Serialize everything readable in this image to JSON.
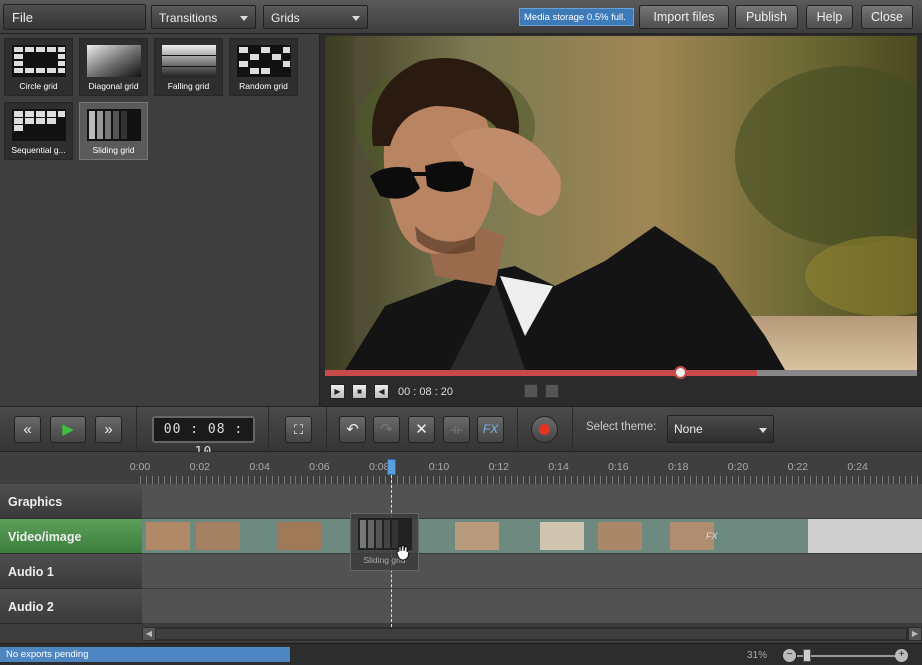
{
  "header": {
    "file_menu": "File",
    "category_dropdown": "Transitions",
    "subcategory_dropdown": "Grids",
    "storage_status": "Media storage 0.5% full.",
    "import_button": "Import files",
    "publish_button": "Publish",
    "help_button": "Help",
    "close_button": "Close"
  },
  "gallery": {
    "items": [
      {
        "label": "Circle grid",
        "selected": false
      },
      {
        "label": "Diagonal grid",
        "selected": false
      },
      {
        "label": "Falling grid",
        "selected": false
      },
      {
        "label": "Random grid",
        "selected": false
      },
      {
        "label": "Sequential g...",
        "selected": false
      },
      {
        "label": "Sliding grid",
        "selected": true
      }
    ]
  },
  "player": {
    "time": "00 : 08 : 20",
    "progress": 0.73
  },
  "toolbar": {
    "rewind_icon": "«",
    "play_icon": "▶",
    "forward_icon": "»",
    "timecode": "00 : 08 : 10",
    "fullscreen_icon": "⛶",
    "undo_icon": "↶",
    "redo_icon": "↷",
    "delete_icon": "✕",
    "split_icon": "⟛",
    "fx_label": "FX",
    "theme_label": "Select theme:",
    "theme_value": "None"
  },
  "ruler": {
    "labels": [
      "0:00",
      "0:02",
      "0:04",
      "0:06",
      "0:08",
      "0:10",
      "0:12",
      "0:14",
      "0:16",
      "0:18",
      "0:20",
      "0:22",
      "0:24"
    ],
    "playhead_time": "0:08.2"
  },
  "tracks": [
    {
      "name": "Graphics",
      "active": false
    },
    {
      "name": "Video/image",
      "active": true
    },
    {
      "name": "Audio 1",
      "active": false
    },
    {
      "name": "Audio 2",
      "active": false
    }
  ],
  "drag_item": {
    "label": "Sliding grid"
  },
  "clip_fx_badge": "FX",
  "status": {
    "exports": "No exports pending",
    "zoom": "31%",
    "zoom_out_icon": "−",
    "zoom_in_icon": "+"
  },
  "colors": {
    "accent_blue": "#3d7bb8",
    "active_track": "#4a8f4a",
    "record_red": "#e0341f",
    "scrubber_red": "#c84a4a"
  }
}
